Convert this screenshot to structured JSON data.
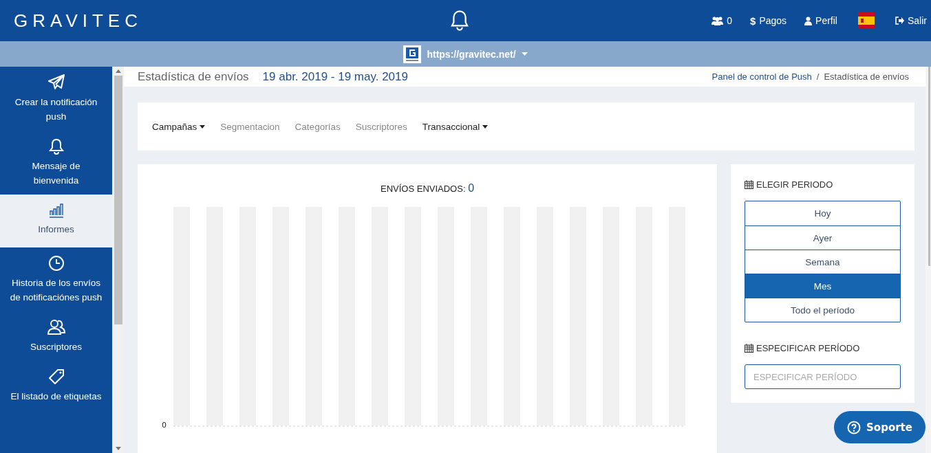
{
  "header": {
    "logo": "GRAVITEC",
    "user_count": "0",
    "nav": [
      {
        "kind": "payments",
        "icon": "$",
        "label": "Pagos"
      },
      {
        "kind": "profile",
        "label": "Perfil"
      },
      {
        "kind": "flag"
      },
      {
        "kind": "logout",
        "label": "Salir"
      }
    ]
  },
  "site_bar": {
    "url": "https://gravitec.net/"
  },
  "sidebar": {
    "items": [
      {
        "kind": "send",
        "label": "Crear la notificación push",
        "selected": false
      },
      {
        "kind": "bell",
        "label": "Mensaje de bienvenida",
        "selected": false
      },
      {
        "kind": "chart",
        "label": "Informes",
        "selected": true
      },
      {
        "kind": "clock",
        "label": "Historia de los envíos de notificaciónes push",
        "selected": false
      },
      {
        "kind": "users",
        "label": "Suscriptores",
        "selected": false
      },
      {
        "kind": "tag",
        "label": "El listado de etiquetas",
        "selected": false
      }
    ]
  },
  "page": {
    "title": "Estadística de envíos",
    "date_range": "19 abr. 2019 - 19 may. 2019",
    "breadcrumb": [
      "Panel de control de Push",
      "Estadística de envíos"
    ],
    "breadcrumb_separator": "/"
  },
  "tabs": [
    {
      "label": "Campañas",
      "dropdown": true,
      "disabled": false
    },
    {
      "label": "Segmentacion",
      "dropdown": false,
      "disabled": true
    },
    {
      "label": "Categorías",
      "dropdown": false,
      "disabled": true
    },
    {
      "label": "Suscriptores",
      "dropdown": false,
      "disabled": true
    },
    {
      "label": "Transaccional",
      "dropdown": true,
      "disabled": false
    }
  ],
  "chart": {
    "title": "ENVÍOS ENVIADOS:",
    "total": "0",
    "y_label": "0"
  },
  "period": {
    "heading": "ELEGIR PERIODO",
    "options": [
      {
        "label": "Hoy",
        "selected": false
      },
      {
        "label": "Ayer",
        "selected": false
      },
      {
        "label": "Semana",
        "selected": false
      },
      {
        "label": "Mes",
        "selected": true
      },
      {
        "label": "Todo el período",
        "selected": false
      }
    ],
    "custom_heading": "ESPECIFICAR PERÍODO",
    "placeholder": "ESPECIFICAR PERÍODO"
  },
  "support_button": "Soporte"
}
